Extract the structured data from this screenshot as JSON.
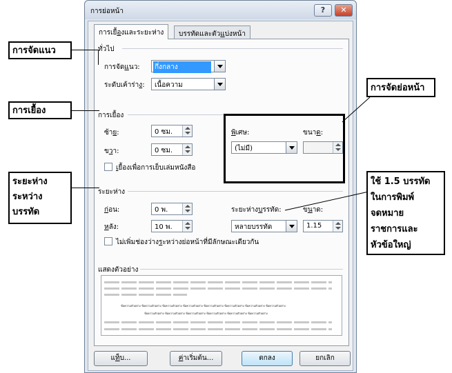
{
  "dialog": {
    "title": "การย่อหน้า",
    "help_label": "?",
    "close_label": "✕",
    "tabs": [
      {
        "label_pre": "การเยื้",
        "label_u": "อ",
        "label_post": "งและระยะห่าง"
      },
      {
        "label_pre": "บรรทัดและตัว",
        "label_u": "แ",
        "label_post": "บ่งหน้า"
      }
    ],
    "general": {
      "heading": "ทั่วไป",
      "alignment_label_pre": "การจัด",
      "alignment_label_u": "แ",
      "alignment_label_post": "นว:",
      "alignment_value": "กึ่งกลาง",
      "outline_label_pre": "ระดับเค้าร่า",
      "outline_label_u": "ง",
      "outline_label_post": ":",
      "outline_value": "เนื้อความ"
    },
    "indent": {
      "heading": "การเยื้อง",
      "left_label_pre": "ซ้า",
      "left_label_u": "ย",
      "left_label_post": ":",
      "left_value": "0 ซม.",
      "right_label_pre": "ข",
      "right_label_u": "ว",
      "right_label_post": "า:",
      "right_value": "0 ซม.",
      "special_label_pre": "",
      "special_label_u": "พ",
      "special_label_post": "ิเศษ:",
      "special_value": "(ไม่มี)",
      "by_label_pre": "ขนา",
      "by_label_u": "ด",
      "by_label_post": ":",
      "by_value": "",
      "mirror_label_pre": "",
      "mirror_label_u": "เ",
      "mirror_label_post": "ยื้องเพื่อการเย็บเล่มหนังสือ"
    },
    "spacing": {
      "heading": "ระยะห่าง",
      "before_label_pre": "",
      "before_label_u": "ก",
      "before_label_post": "่อน:",
      "before_value": "0 พ.",
      "after_label_pre": "",
      "after_label_u": "ห",
      "after_label_post": "ลัง:",
      "after_value": "10 พ.",
      "line_label_pre": "ระยะห่าง",
      "line_label_u": "บ",
      "line_label_post": "รรทัด:",
      "line_value": "หลายบรรทัด",
      "at_label_pre": "ข",
      "at_label_u": "น",
      "at_label_post": "าด:",
      "at_value": "1.15",
      "nospace_label_pre": "ไม่เพิ่มช่องว่าง",
      "nospace_label_u": "ร",
      "nospace_label_post": "ะหว่างย่อหน้าที่มีลักษณะเดียวกัน"
    },
    "preview": {
      "heading": "แสดงตัวอย่าง",
      "sample_line_1": "ข้อความตัวอย่าง ข้อความตัวอย่าง ข้อความตัวอย่าง ข้อความตัวอย่าง ข้อความตัวอย่าง ข้อความตัวอย่าง ข้อความตัวอย่าง ข้อความตัวอย่าง",
      "sample_line_2": "ข้อความตัวอย่าง ข้อความตัวอย่าง ข้อความตัวอย่าง ข้อความตัวอย่าง ข้อความตัวอย่าง ข้อความตัวอย่าง"
    },
    "buttons": {
      "tabs_pre": "แ",
      "tabs_u": "ท",
      "tabs_post": "็บ...",
      "default_pre": "",
      "default_u": "ค",
      "default_post": "่าเริ่มต้น...",
      "ok": "ตกลง",
      "cancel": "ยกเลิก"
    }
  },
  "annotations": {
    "alignment": "การจัดแนว",
    "indent": "การเยื้อง",
    "spacing": "ระยะห่าง\nระหว่าง\nบรรทัด",
    "indent_paragraph": "การจัดย่อหน้า",
    "line_note": "ใช้ 1.5 บรรทัด\nในการพิมพ์\nจดหมาย\nราชการและ\nหัวข้อใหญ่"
  }
}
